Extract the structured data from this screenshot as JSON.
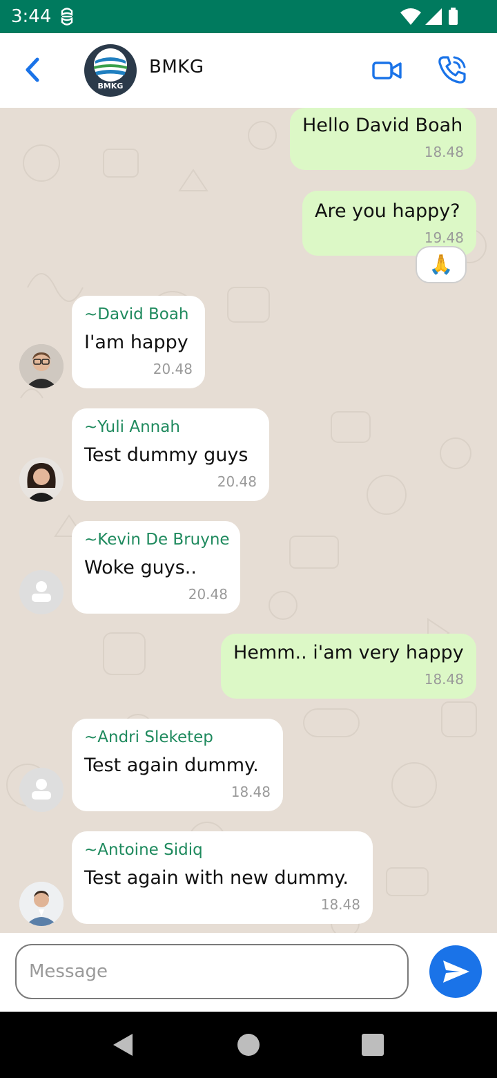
{
  "status_bar": {
    "time": "3:44"
  },
  "header": {
    "title": "BMKG",
    "logo_text": "BMKG"
  },
  "chat": {
    "messages": [
      {
        "type": "out",
        "text": "Hello David Boah",
        "time": "18.48"
      },
      {
        "type": "out",
        "text": "Are you happy?",
        "time": "19.48",
        "reaction": "🙏"
      },
      {
        "type": "in",
        "sender": "~David Boah",
        "text": "I'am happy",
        "time": "20.48"
      },
      {
        "type": "in",
        "sender": "~Yuli Annah",
        "text": "Test dummy guys",
        "time": "20.48"
      },
      {
        "type": "in",
        "sender": "~Kevin De Bruyne",
        "text": "Woke guys..",
        "time": "20.48"
      },
      {
        "type": "out",
        "text": "Hemm.. i'am very happy",
        "time": "18.48"
      },
      {
        "type": "in",
        "sender": "~Andri Sleketep",
        "text": "Test again dummy.",
        "time": "18.48"
      },
      {
        "type": "in",
        "sender": "~Antoine Sidiq",
        "text": "Test again with new dummy.",
        "time": "18.48"
      }
    ]
  },
  "input": {
    "placeholder": "Message",
    "value": ""
  },
  "colors": {
    "status_bar": "#007a5e",
    "outgoing_bubble": "#dcf8c6",
    "incoming_bubble": "#ffffff",
    "sender_name": "#1f8a5e",
    "accent_blue": "#1a73e8"
  },
  "icons": {
    "back": "chevron-left-icon",
    "video": "video-camera-icon",
    "call": "phone-icon",
    "send": "send-icon"
  }
}
